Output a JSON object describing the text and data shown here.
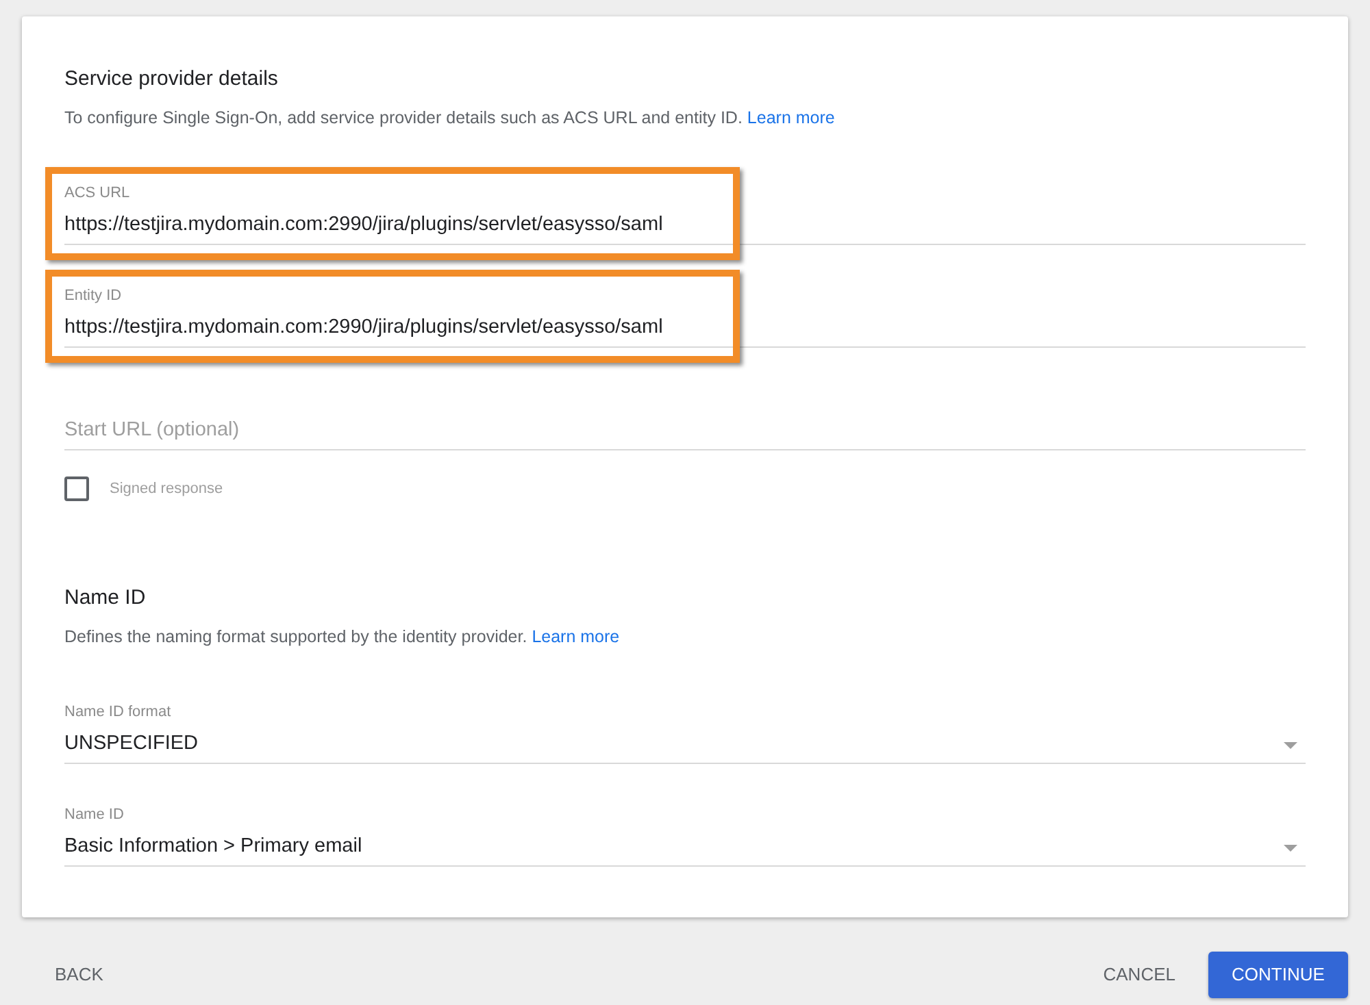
{
  "sections": [
    {
      "title": "Service provider details",
      "description": "To configure Single Sign-On, add service provider details such as ACS URL and entity ID.",
      "link": "Learn more",
      "fields": [
        {
          "kind": "text",
          "label": "ACS URL",
          "value": "https://testjira.mydomain.com:2990/jira/plugins/servlet/easysso/saml",
          "highlighted": true
        },
        {
          "kind": "text",
          "label": "Entity ID",
          "value": "https://testjira.mydomain.com:2990/jira/plugins/servlet/easysso/saml",
          "highlighted": true
        },
        {
          "kind": "text",
          "placeholder": "Start URL (optional)",
          "highlighted": false
        },
        {
          "kind": "checkbox",
          "label": "Signed response",
          "checked": false
        }
      ]
    },
    {
      "title": "Name ID",
      "description": "Defines the naming format supported by the identity provider.",
      "link": "Learn more",
      "fields": [
        {
          "kind": "select",
          "label": "Name ID format",
          "value": "UNSPECIFIED"
        },
        {
          "kind": "select",
          "label": "Name ID",
          "value": "Basic Information > Primary email"
        }
      ]
    }
  ],
  "footer": {
    "back": "BACK",
    "cancel": "CANCEL",
    "continue": "CONTINUE"
  }
}
